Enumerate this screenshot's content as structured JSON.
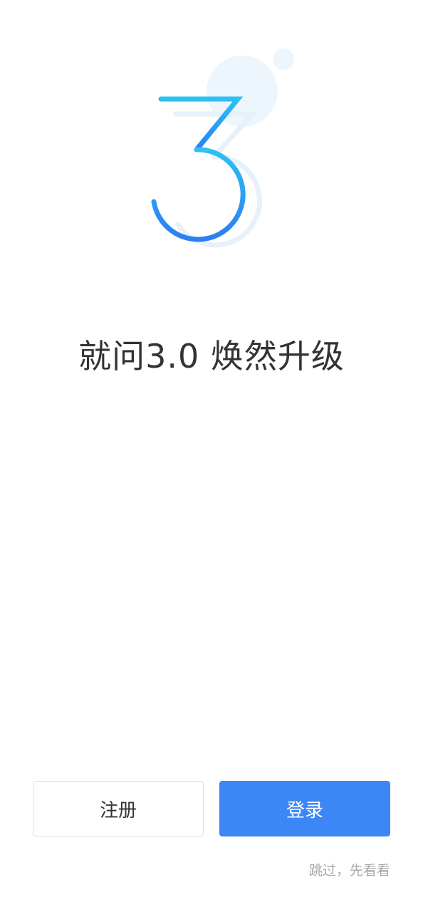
{
  "hero": {
    "logo_icon": "number-three-logo-icon",
    "colors": {
      "primary_gradient_start": "#2ec1f4",
      "primary_gradient_end": "#2a7ff0",
      "shadow": "#e6f1fc",
      "bubble": "#edf5fd"
    }
  },
  "headline": {
    "text": "就问3.0  焕然升级"
  },
  "actions": {
    "register_label": "注册",
    "login_label": "登录",
    "skip_label": "跳过，先看看"
  },
  "colors": {
    "accent": "#3d86f6",
    "text_primary": "#333333",
    "text_muted": "#a8a8a8",
    "border": "#dedede"
  }
}
